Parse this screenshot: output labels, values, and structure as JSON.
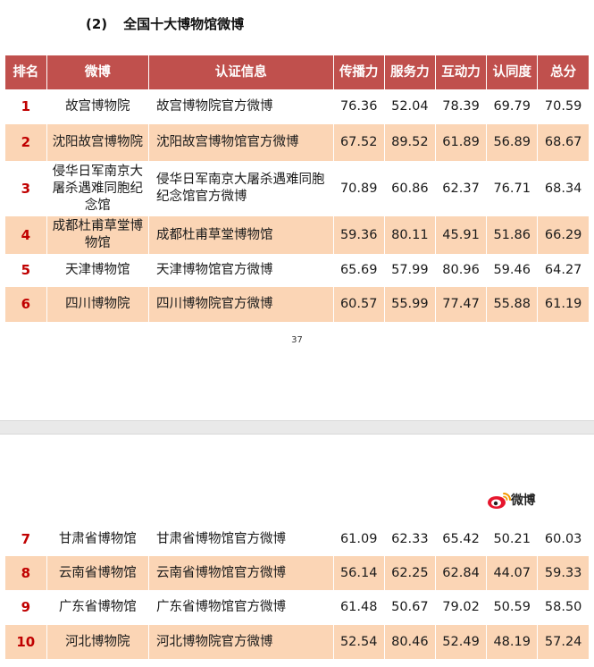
{
  "section": {
    "number": "(2)",
    "title": "全国十大博物馆微博"
  },
  "table": {
    "headers": [
      "排名",
      "微博",
      "认证信息",
      "传播力",
      "服务力",
      "互动力",
      "认同度",
      "总分"
    ],
    "rows": [
      {
        "rank": "1",
        "name": "故宫博物院",
        "cert": "故宫博物院官方微博",
        "spread": "76.36",
        "service": "52.04",
        "interaction": "78.39",
        "recognition": "69.79",
        "total": "70.59"
      },
      {
        "rank": "2",
        "name": "沈阳故宫博物院",
        "cert": "沈阳故宫博物馆官方微博",
        "spread": "67.52",
        "service": "89.52",
        "interaction": "61.89",
        "recognition": "56.89",
        "total": "68.67"
      },
      {
        "rank": "3",
        "name": "侵华日军南京大屠杀遇难同胞纪念馆",
        "cert": "侵华日军南京大屠杀遇难同胞纪念馆官方微博",
        "spread": "70.89",
        "service": "60.86",
        "interaction": "62.37",
        "recognition": "76.71",
        "total": "68.34"
      },
      {
        "rank": "4",
        "name": "成都杜甫草堂博物馆",
        "cert": "成都杜甫草堂博物馆",
        "spread": "59.36",
        "service": "80.11",
        "interaction": "45.91",
        "recognition": "51.86",
        "total": "66.29"
      },
      {
        "rank": "5",
        "name": "天津博物馆",
        "cert": "天津博物馆官方微博",
        "spread": "65.69",
        "service": "57.99",
        "interaction": "80.96",
        "recognition": "59.46",
        "total": "64.27"
      },
      {
        "rank": "6",
        "name": "四川博物院",
        "cert": "四川博物院官方微博",
        "spread": "60.57",
        "service": "55.99",
        "interaction": "77.47",
        "recognition": "55.88",
        "total": "61.19"
      },
      {
        "rank": "7",
        "name": "甘肃省博物馆",
        "cert": "甘肃省博物馆官方微博",
        "spread": "61.09",
        "service": "62.33",
        "interaction": "65.42",
        "recognition": "50.21",
        "total": "60.03"
      },
      {
        "rank": "8",
        "name": "云南省博物馆",
        "cert": "云南省博物馆官方微博",
        "spread": "56.14",
        "service": "62.25",
        "interaction": "62.84",
        "recognition": "44.07",
        "total": "59.33"
      },
      {
        "rank": "9",
        "name": "广东省博物馆",
        "cert": "广东省博物馆官方微博",
        "spread": "61.48",
        "service": "50.67",
        "interaction": "79.02",
        "recognition": "50.59",
        "total": "58.50"
      },
      {
        "rank": "10",
        "name": "河北博物院",
        "cert": "河北博物院官方微博",
        "spread": "52.54",
        "service": "80.46",
        "interaction": "52.49",
        "recognition": "48.19",
        "total": "57.24"
      }
    ]
  },
  "page_number": "37",
  "logo": {
    "text": "微博",
    "icon": "weibo-logo-icon"
  },
  "colors": {
    "header_bg": "#c0504d",
    "alt_row_bg": "#fbd5b5",
    "rank_text": "#c00000",
    "page_gap": "#e9e9e9"
  }
}
